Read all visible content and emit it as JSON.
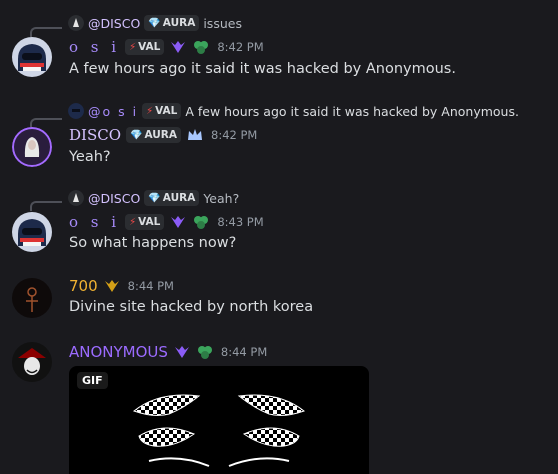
{
  "messages": [
    {
      "reply": {
        "name": "@DISCO",
        "tag_label": "AURA",
        "text": "issues"
      },
      "author": {
        "name": "o s i",
        "tag_label": "VAL"
      },
      "timestamp": "8:42 PM",
      "text": "A few hours ago it said it was hacked by Anonymous."
    },
    {
      "reply": {
        "name": "@o s i",
        "tag_label": "VAL",
        "text": "A few hours ago it said it was hacked by Anonymous."
      },
      "author": {
        "name": "DISCO",
        "tag_label": "AURA"
      },
      "timestamp": "8:42 PM",
      "text": "Yeah?"
    },
    {
      "reply": {
        "name": "@DISCO",
        "tag_label": "AURA",
        "text": "Yeah?"
      },
      "author": {
        "name": "o s i",
        "tag_label": "VAL"
      },
      "timestamp": "8:43 PM",
      "text": "So what happens now?"
    },
    {
      "author": {
        "name": "700"
      },
      "timestamp": "8:44 PM",
      "text": "Divine site hacked by north korea"
    },
    {
      "author": {
        "name": "ANONYMOUS"
      },
      "timestamp": "8:44 PM",
      "attachment_label": "GIF"
    }
  ],
  "colors": {
    "background": "#1a1a1e",
    "osi_name": "#a78bfa",
    "disco_name": "#d4c2ff",
    "seven_hundred_name": "#f0b232",
    "anonymous_name": "#9b6bff",
    "timestamp": "#949ba4"
  },
  "icons": {
    "val_tag": "lightning-icon",
    "aura_tag": "gem-icon",
    "role_badge_1": "purple-wings-icon",
    "role_badge_2": "green-leaf-icon",
    "role_badge_3": "crown-icon",
    "role_badge_4": "gold-wings-icon"
  }
}
